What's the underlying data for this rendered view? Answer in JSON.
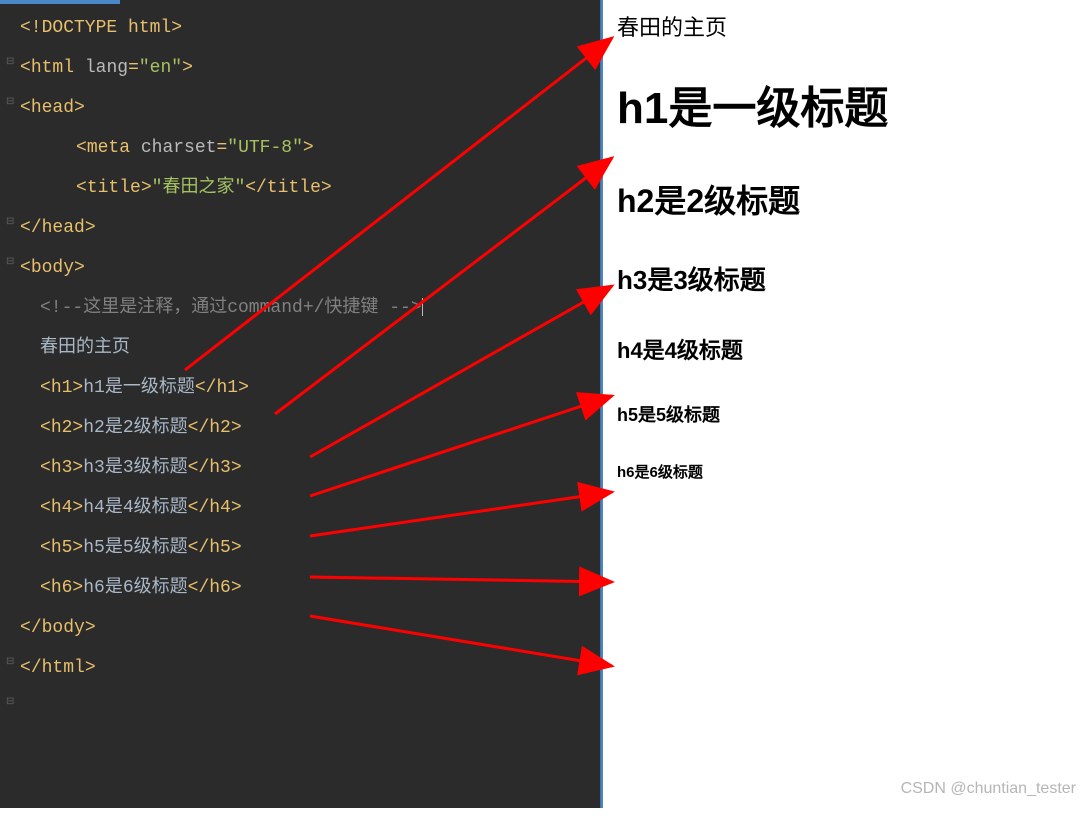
{
  "editor": {
    "lines": {
      "doctype": "<!DOCTYPE html>",
      "html_open_tag": "html",
      "html_attr_name": "lang",
      "html_attr_val": "\"en\"",
      "head_open": "head",
      "meta_tag": "meta",
      "meta_attr_name": "charset",
      "meta_attr_val": "\"UTF-8\"",
      "title_tag": "title",
      "title_content": "\"春田之家\"",
      "head_close": "/head",
      "body_open": "body",
      "comment_text": "<!--这里是注释，通过command+/快捷键 -->",
      "plain_text": "春田的主页",
      "h1_tag": "h1",
      "h1_text": "h1是一级标题",
      "h2_tag": "h2",
      "h2_text": "h2是2级标题",
      "h3_tag": "h3",
      "h3_text": "h3是3级标题",
      "h4_tag": "h4",
      "h4_text": "h4是4级标题",
      "h5_tag": "h5",
      "h5_text": "h5是5级标题",
      "h6_tag": "h6",
      "h6_text": "h6是6级标题",
      "body_close": "/body",
      "html_close": "/html"
    }
  },
  "preview": {
    "plain": "春田的主页",
    "h1": "h1是一级标题",
    "h2": "h2是2级标题",
    "h3": "h3是3级标题",
    "h4": "h4是4级标题",
    "h5": "h5是5级标题",
    "h6": "h6是6级标题"
  },
  "watermark": "CSDN @chuntian_tester",
  "colors": {
    "editor_bg": "#2b2b2b",
    "tag": "#e8bf6a",
    "attr_val": "#a5c261",
    "comment": "#808080",
    "arrow": "#ff0000"
  }
}
